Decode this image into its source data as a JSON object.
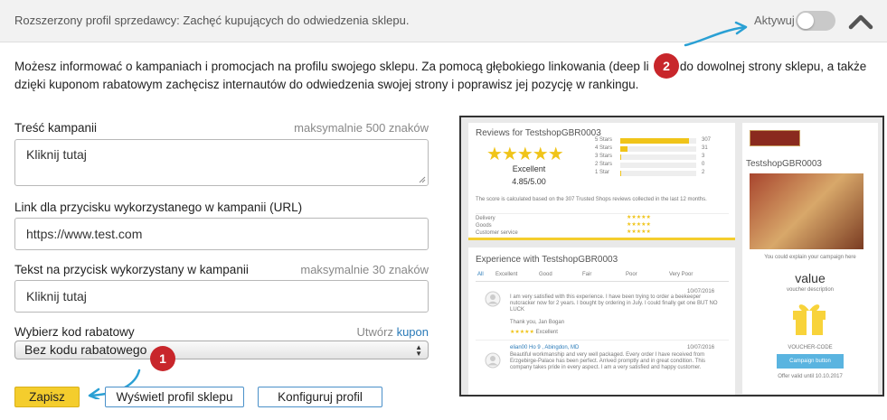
{
  "header": {
    "title": "Rozszerzony profil sprzedawcy: Zachęć kupujących do odwiedzenia sklepu.",
    "toggle_label": "Aktywuj",
    "toggle_on": false
  },
  "intro": {
    "part1": "Możesz informować o kampaniach i promocjach na profilu swojego sklepu. Za pomocą głębokiego linkowania (deep li",
    "part2": ") do dowolnej strony sklepu, a także dzięki kuponom rabatowym zachęcisz internautów do odwiedzenia swojej strony i poprawisz jej pozycję w rankingu."
  },
  "form": {
    "campaign_text": {
      "label": "Treść kampanii",
      "hint": "maksymalnie 500 znaków",
      "value": "Kliknij tutaj"
    },
    "campaign_link": {
      "label": "Link dla przycisku wykorzystanego w kampanii (URL)",
      "value": "https://www.test.com"
    },
    "button_text": {
      "label": "Tekst na przycisk wykorzystany w kampanii",
      "hint": "maksymalnie 30 znaków",
      "value": "Kliknij tutaj"
    },
    "coupon": {
      "label": "Wybierz kod rabatowy",
      "hint_prefix": "Utwórz ",
      "hint_link": "kupon",
      "selected": "Bez kodu rabatowego"
    }
  },
  "buttons": {
    "save": "Zapisz",
    "view_profile": "Wyświetl profil sklepu",
    "configure_profile": "Konfiguruj profil"
  },
  "badges": {
    "one": "1",
    "two": "2"
  },
  "colors": {
    "primary_button": "#f4cd2d",
    "badge": "#c8262b",
    "arrow": "#2aa0d4",
    "link": "#2a7ab8"
  },
  "preview": {
    "reviews_title": "Reviews for TestshopGBR0003",
    "rating_word": "Excellent",
    "rating_score": "4.85/5.00",
    "star_rows": [
      {
        "label": "5 Stars",
        "count": "307",
        "fraction": 0.9
      },
      {
        "label": "4 Stars",
        "count": "31",
        "fraction": 0.1
      },
      {
        "label": "3 Stars",
        "count": "3",
        "fraction": 0.01
      },
      {
        "label": "2 Stars",
        "count": "0",
        "fraction": 0
      },
      {
        "label": "1 Star",
        "count": "2",
        "fraction": 0.01
      }
    ],
    "experience_title": "Experience with TestshopGBR0003",
    "experience_tabs": [
      "All",
      "Excellent",
      "Good",
      "Fair",
      "Poor",
      "Very Poor"
    ],
    "reviews": [
      {
        "date": "10/07/2016",
        "text": "I am very satisfied with this experience. I have been trying to order a beekeeper nutcracker now for 2 years. I bought by ordering in July. I could finally get one BUT NO LUCK",
        "thanks": "Thank you, Jan Bogan",
        "rating": "Excellent"
      },
      {
        "date": "10/07/2016",
        "name": "elian00 Ho 9 , Abingdon, MD",
        "text": "Beautiful workmanship and very well packaged. Every order I have received from Erzgebirge-Palace has been perfect. Arrived promptly and in great condition. This company takes pride in every aspect. I am a very satisfied and happy customer."
      }
    ],
    "shop_name": "TestshopGBR0003",
    "side_note": "You could explain your campaign here",
    "voucher_value": "value",
    "voucher_desc": "voucher description",
    "voucher_code": "VOUCHER-CODE",
    "campaign_button": "Campaign button",
    "offer_valid": "Offer valid until 10.10.2017"
  }
}
